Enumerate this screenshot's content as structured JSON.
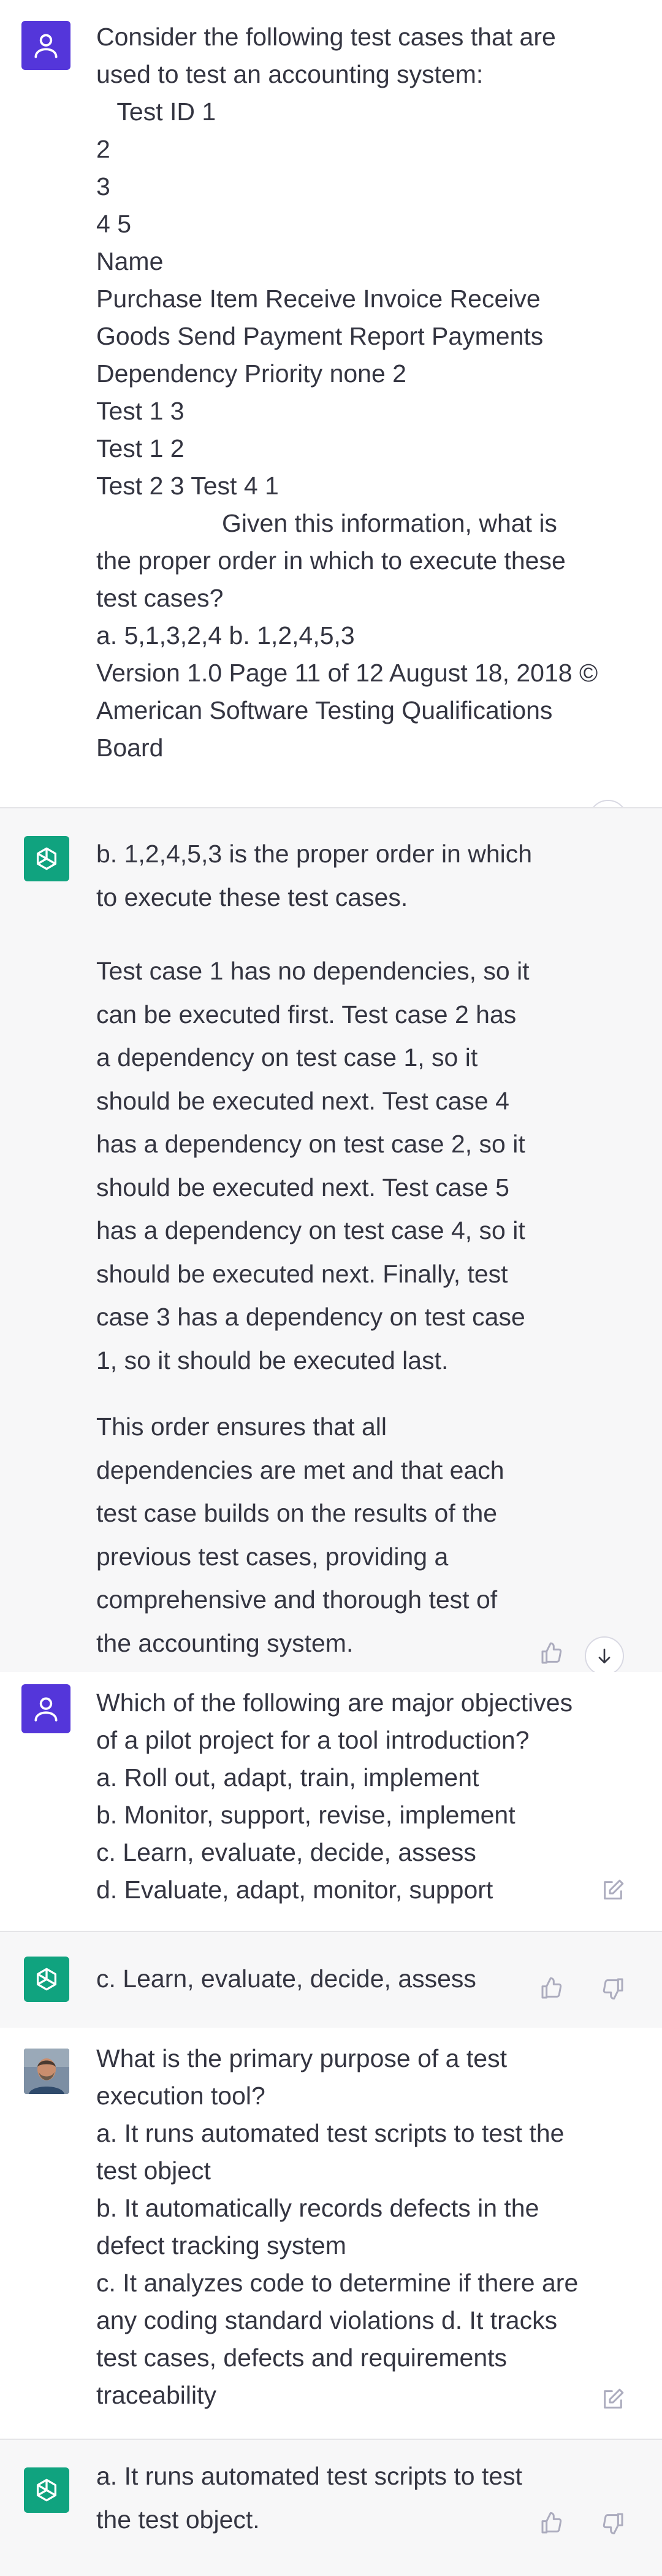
{
  "conversation": [
    {
      "role": "user",
      "lines": [
        "Consider the following test cases that are",
        "used to test an accounting system:",
        "   Test ID 1",
        "2",
        "3",
        "4 5",
        "Name",
        "Purchase Item Receive Invoice Receive",
        "Goods Send Payment Report Payments",
        "Dependency Priority none 2",
        "Test 1 3",
        "Test 1 2",
        "Test 2 3 Test 4 1",
        "                  Given this information, what is",
        "the proper order in which to execute these",
        "test cases?",
        "a. 5,1,3,2,4 b. 1,2,4,5,3",
        "Version 1.0 Page 11 of 12 August 18, 2018 ©",
        "American Software Testing Qualifications",
        "Board"
      ]
    },
    {
      "role": "assistant",
      "paragraphs": [
        [
          "b. 1,2,4,5,3 is the proper order in which",
          "to execute these test cases."
        ],
        [
          "Test case 1 has no dependencies, so it",
          "can be executed first. Test case 2 has",
          "a dependency on test case 1, so it",
          "should be executed next. Test case 4",
          "has a dependency on test case 2, so it",
          "should be executed next. Test case 5",
          "has a dependency on test case 4, so it",
          "should be executed next. Finally, test",
          "case 3 has a dependency on test case",
          "1, so it should be executed last."
        ],
        [
          "This order ensures that all",
          "dependencies are met and that each",
          "test case builds on the results of the",
          "previous test cases, providing a",
          "comprehensive and thorough test of",
          "the accounting system."
        ]
      ]
    },
    {
      "role": "user",
      "lines": [
        "Which of the following are major objectives",
        "of a pilot project for a tool introduction?",
        "a. Roll out, adapt, train, implement",
        "b. Monitor, support, revise, implement",
        "c. Learn, evaluate, decide, assess",
        "d. Evaluate, adapt, monitor, support"
      ]
    },
    {
      "role": "assistant",
      "lines": [
        "c. Learn, evaluate, decide, assess"
      ]
    },
    {
      "role": "user",
      "lines": [
        "What is the primary purpose of a test",
        "execution tool?",
        "a. It runs automated test scripts to test the",
        "test object",
        "b. It automatically records defects in the",
        "defect tracking system",
        "c. It analyzes code to determine if there are",
        "any coding standard violations d. It tracks",
        "test cases, defects and requirements",
        "traceability"
      ]
    },
    {
      "role": "assistant",
      "lines": [
        "a. It runs automated test scripts to test",
        "the test object."
      ]
    }
  ],
  "icons": {
    "user_avatar": "person-icon",
    "assistant_avatar": "openai-logo-icon",
    "photo_avatar": "user-photo-avatar",
    "thumbs_up": "thumbs-up-icon",
    "thumbs_down": "thumbs-down-icon",
    "edit": "edit-icon",
    "scroll_down": "arrow-down-icon"
  },
  "colors": {
    "user_avatar_bg": "#5436da",
    "assistant_avatar_bg": "#10a37f",
    "assistant_bg": "#f7f7f8",
    "text": "#343541",
    "icon": "#acacbe"
  }
}
